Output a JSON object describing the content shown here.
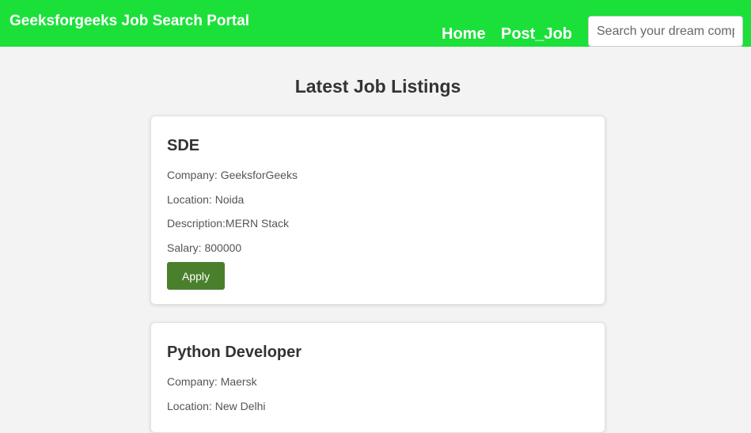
{
  "navbar": {
    "brand": "Geeksforgeeks Job Search Portal",
    "links": [
      "Home",
      "Post_Job"
    ],
    "search_placeholder": "Search your dream company"
  },
  "main": {
    "title": "Latest Job Listings",
    "jobs": [
      {
        "title": "SDE",
        "company": "Company: GeeksforGeeks",
        "location": "Location: Noida",
        "description": "Description:MERN Stack",
        "salary": "Salary: 800000",
        "apply_label": "Apply"
      },
      {
        "title": "Python Developer",
        "company": "Company: Maersk",
        "location": "Location: New Delhi"
      }
    ]
  },
  "colors": {
    "navbar": "#1be03a",
    "background": "#f3f3f3",
    "apply_button": "#4a7f2b"
  }
}
